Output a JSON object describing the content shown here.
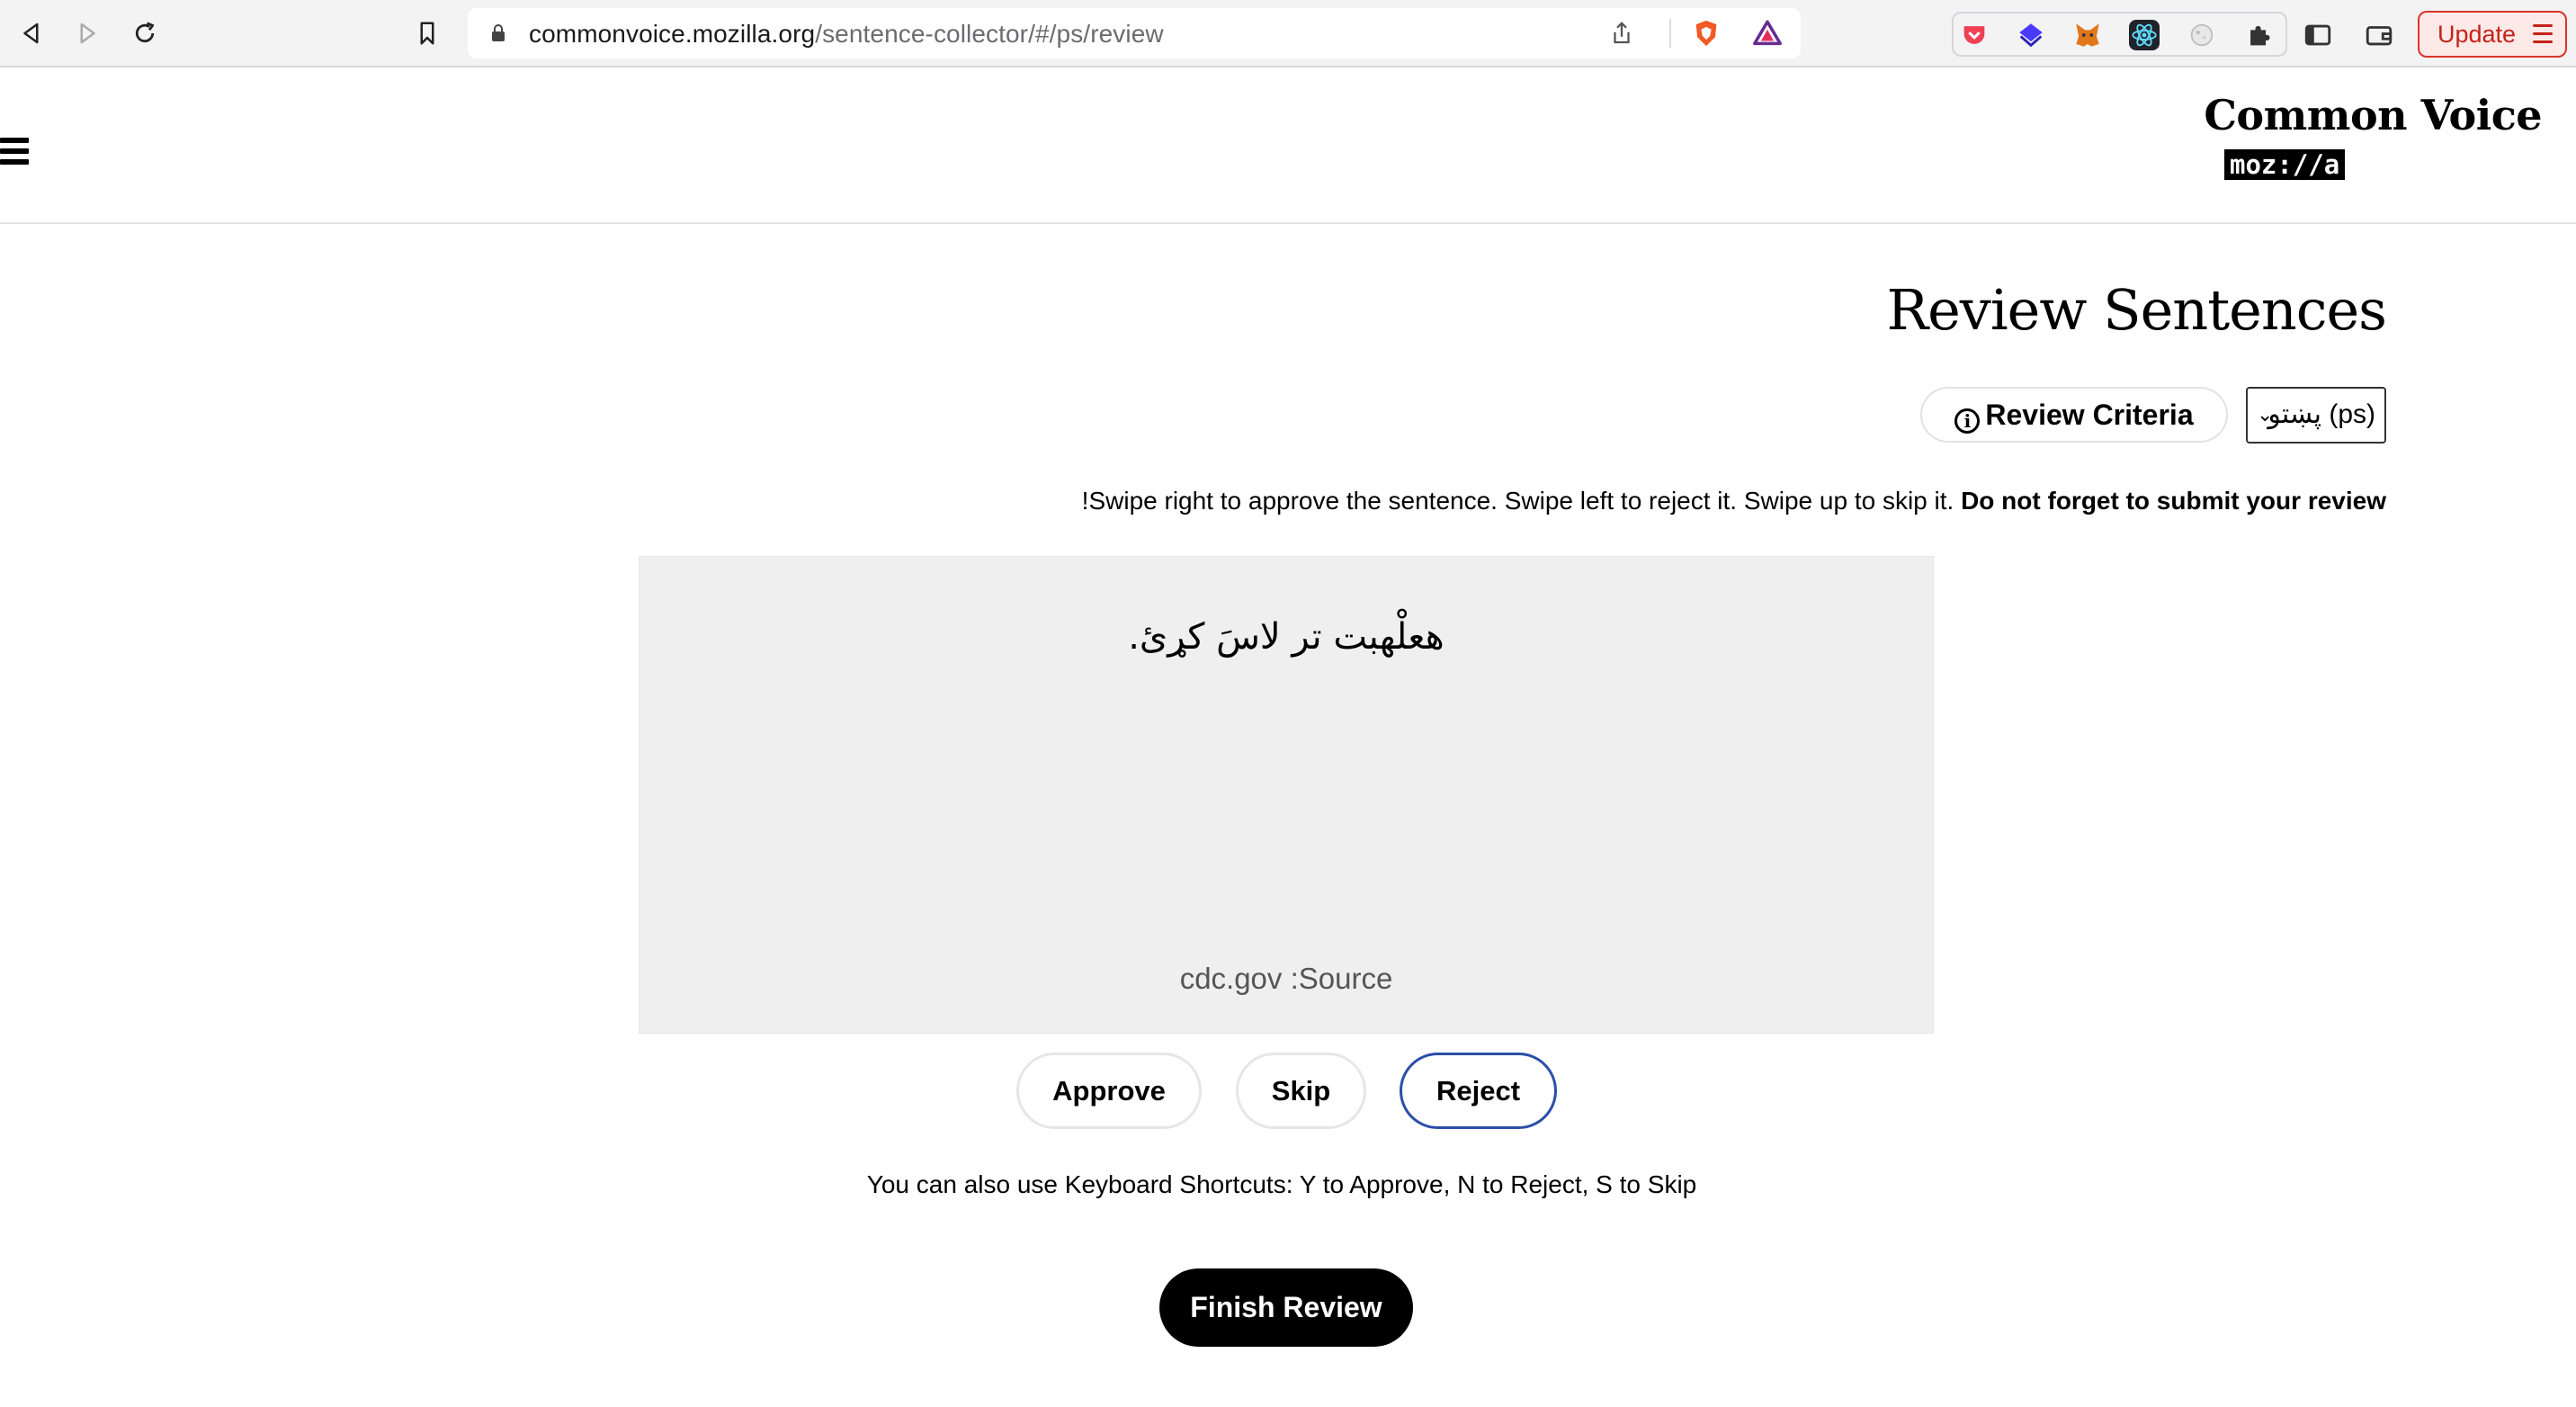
{
  "browser": {
    "url_host": "commonvoice.mozilla.org",
    "url_path": "/sentence-collector/#/ps/review",
    "update_label": "Update"
  },
  "header": {
    "logo_title": "Common Voice",
    "logo_sub": "moz://a"
  },
  "main": {
    "title": "Review Sentences",
    "criteria_label": "Review Criteria",
    "language_value": "پښتو (ps)",
    "instructions_text": "!Swipe right to approve the sentence. Swipe left to reject it. Swipe up to skip it. ",
    "instructions_bold": "Do not forget to submit your review",
    "sentence": "هعلْهبت تر لاسَ کړئ.",
    "source": "cdc.gov :Source",
    "approve_label": "Approve",
    "skip_label": "Skip",
    "reject_label": "Reject",
    "shortcuts": "You can also use Keyboard Shortcuts: Y to Approve, N to Reject, S to Skip",
    "finish_label": "Finish Review"
  },
  "colors": {
    "reject_border": "#2b4fa6",
    "card_bg": "#efefef",
    "update_accent": "#c4221a"
  }
}
